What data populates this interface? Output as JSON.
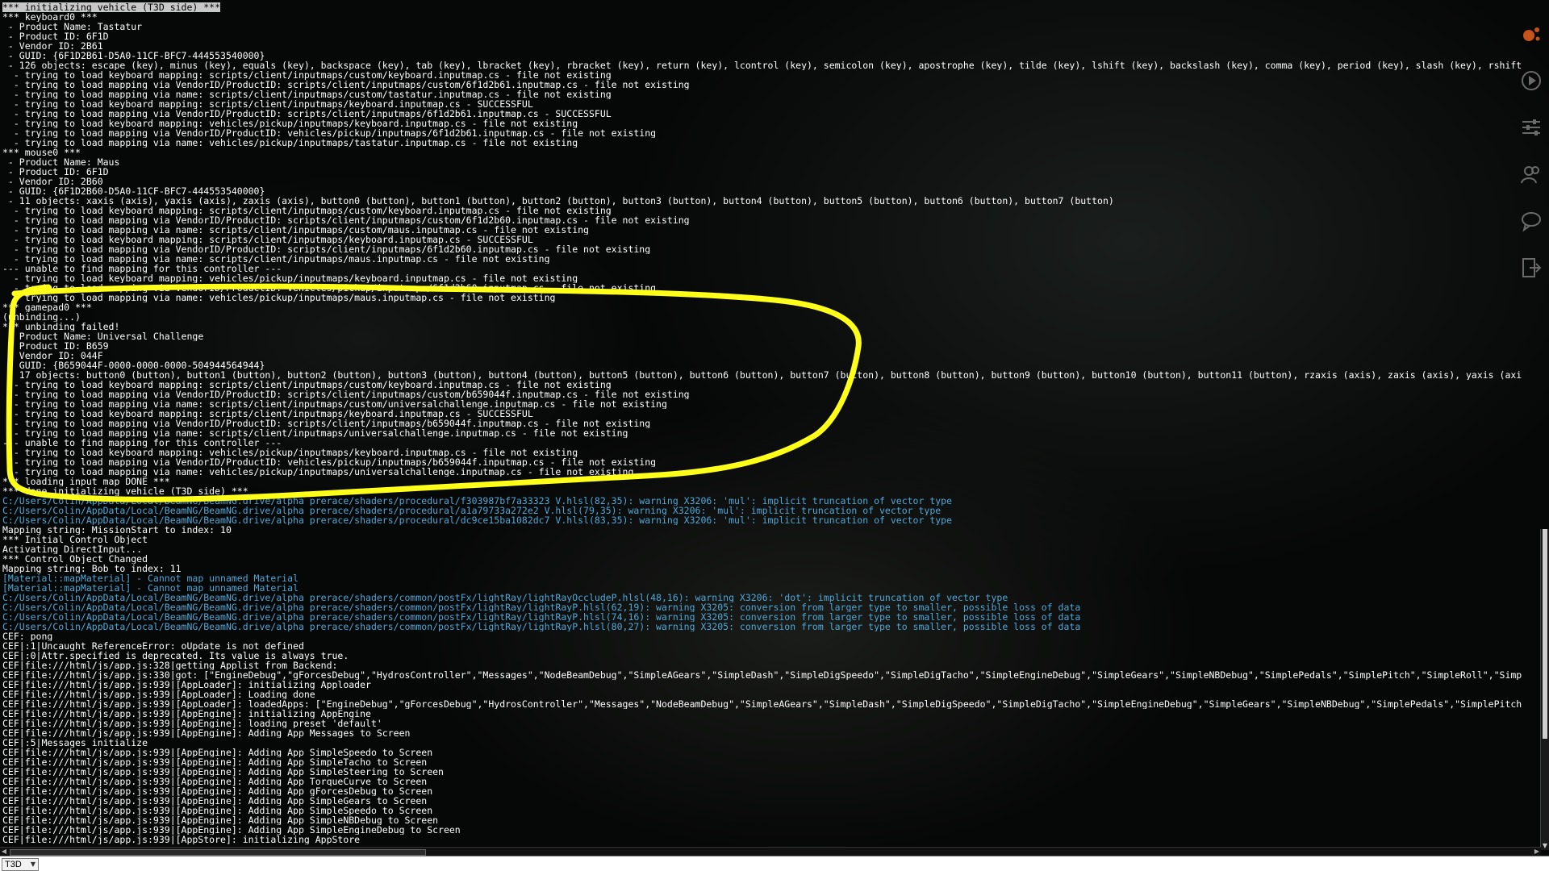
{
  "console": {
    "lines": [
      {
        "text": "*** initializing vehicle (T3D side) ***",
        "type": "normal"
      },
      {
        "text": "*** keyboard0 ***",
        "type": "normal"
      },
      {
        "text": " - Product Name: Tastatur",
        "type": "normal"
      },
      {
        "text": " - Product ID: 6F1D",
        "type": "normal"
      },
      {
        "text": " - Vendor ID: 2B61",
        "type": "normal"
      },
      {
        "text": " - GUID: {6F1D2B61-D5A0-11CF-BFC7-444553540000}",
        "type": "normal"
      },
      {
        "text": " - 126 objects: escape (key), minus (key), equals (key), backspace (key), tab (key), lbracket (key), rbracket (key), return (key), lcontrol (key), semicolon (key), apostrophe (key), tilde (key), lshift (key), backslash (key), comma (key), period (key), slash (key), rshift",
        "type": "normal"
      },
      {
        "text": "  - trying to load keyboard mapping: scripts/client/inputmaps/custom/keyboard.inputmap.cs - file not existing",
        "type": "normal"
      },
      {
        "text": "  - trying to load mapping via VendorID/ProductID: scripts/client/inputmaps/custom/6f1d2b61.inputmap.cs - file not existing",
        "type": "normal"
      },
      {
        "text": "  - trying to load mapping via name: scripts/client/inputmaps/custom/tastatur.inputmap.cs - file not existing",
        "type": "normal"
      },
      {
        "text": "  - trying to load keyboard mapping: scripts/client/inputmaps/keyboard.inputmap.cs - SUCCESSFUL",
        "type": "normal"
      },
      {
        "text": "  - trying to load mapping via VendorID/ProductID: scripts/client/inputmaps/6f1d2b61.inputmap.cs - SUCCESSFUL",
        "type": "normal"
      },
      {
        "text": "  - trying to load keyboard mapping: vehicles/pickup/inputmaps/keyboard.inputmap.cs - file not existing",
        "type": "normal"
      },
      {
        "text": "  - trying to load mapping via VendorID/ProductID: vehicles/pickup/inputmaps/6f1d2b61.inputmap.cs - file not existing",
        "type": "normal"
      },
      {
        "text": "  - trying to load mapping via name: vehicles/pickup/inputmaps/tastatur.inputmap.cs - file not existing",
        "type": "normal"
      },
      {
        "text": "*** mouse0 ***",
        "type": "normal"
      },
      {
        "text": " - Product Name: Maus",
        "type": "normal"
      },
      {
        "text": " - Product ID: 6F1D",
        "type": "normal"
      },
      {
        "text": " - Vendor ID: 2B60",
        "type": "normal"
      },
      {
        "text": " - GUID: {6F1D2B60-D5A0-11CF-BFC7-444553540000}",
        "type": "normal"
      },
      {
        "text": " - 11 objects: xaxis (axis), yaxis (axis), zaxis (axis), button0 (button), button1 (button), button2 (button), button3 (button), button4 (button), button5 (button), button6 (button), button7 (button)",
        "type": "normal"
      },
      {
        "text": "  - trying to load keyboard mapping: scripts/client/inputmaps/custom/keyboard.inputmap.cs - file not existing",
        "type": "normal"
      },
      {
        "text": "  - trying to load mapping via VendorID/ProductID: scripts/client/inputmaps/custom/6f1d2b60.inputmap.cs - file not existing",
        "type": "normal"
      },
      {
        "text": "  - trying to load mapping via name: scripts/client/inputmaps/custom/maus.inputmap.cs - file not existing",
        "type": "normal"
      },
      {
        "text": "  - trying to load keyboard mapping: scripts/client/inputmaps/keyboard.inputmap.cs - SUCCESSFUL",
        "type": "normal"
      },
      {
        "text": "  - trying to load mapping via VendorID/ProductID: scripts/client/inputmaps/6f1d2b60.inputmap.cs - file not existing",
        "type": "normal"
      },
      {
        "text": "  - trying to load mapping via name: scripts/client/inputmaps/maus.inputmap.cs - file not existing",
        "type": "normal"
      },
      {
        "text": "--- unable to find mapping for this controller ---",
        "type": "normal"
      },
      {
        "text": "  - trying to load keyboard mapping: vehicles/pickup/inputmaps/keyboard.inputmap.cs - file not existing",
        "type": "normal"
      },
      {
        "text": "  - trying to load mapping via VendorID/ProductID: vehicles/pickup/inputmaps/6f1d2b60.inputmap.cs - file not existing",
        "type": "normal"
      },
      {
        "text": "  - trying to load mapping via name: vehicles/pickup/inputmaps/maus.inputmap.cs - file not existing",
        "type": "normal"
      },
      {
        "text": "*** gamepad0 ***",
        "type": "normal"
      },
      {
        "text": "(unbinding...)",
        "type": "normal"
      },
      {
        "text": "*** unbinding failed!",
        "type": "normal"
      },
      {
        "text": " - Product Name: Universal Challenge",
        "type": "normal"
      },
      {
        "text": " - Product ID: B659",
        "type": "normal"
      },
      {
        "text": " - Vendor ID: 044F",
        "type": "normal"
      },
      {
        "text": " - GUID: {B659044F-0000-0000-0000-504944564944}",
        "type": "normal"
      },
      {
        "text": " - 17 objects: button0 (button), button1 (button), button2 (button), button3 (button), button4 (button), button5 (button), button6 (button), button7 (button), button8 (button), button9 (button), button10 (button), button11 (button), rzaxis (axis), zaxis (axis), yaxis (axi",
        "type": "normal"
      },
      {
        "text": "  - trying to load keyboard mapping: scripts/client/inputmaps/custom/keyboard.inputmap.cs - file not existing",
        "type": "normal"
      },
      {
        "text": "  - trying to load mapping via VendorID/ProductID: scripts/client/inputmaps/custom/b659044f.inputmap.cs - file not existing",
        "type": "normal"
      },
      {
        "text": "  - trying to load mapping via name: scripts/client/inputmaps/custom/universalchallenge.inputmap.cs - file not existing",
        "type": "normal"
      },
      {
        "text": "  - trying to load keyboard mapping: scripts/client/inputmaps/keyboard.inputmap.cs - SUCCESSFUL",
        "type": "normal"
      },
      {
        "text": "  - trying to load mapping via VendorID/ProductID: scripts/client/inputmaps/b659044f.inputmap.cs - file not existing",
        "type": "normal"
      },
      {
        "text": "  - trying to load mapping via name: scripts/client/inputmaps/universalchallenge.inputmap.cs - file not existing",
        "type": "normal"
      },
      {
        "text": "--- unable to find mapping for this controller ---",
        "type": "normal"
      },
      {
        "text": "  - trying to load keyboard mapping: vehicles/pickup/inputmaps/keyboard.inputmap.cs - file not existing",
        "type": "normal"
      },
      {
        "text": "  - trying to load mapping via VendorID/ProductID: vehicles/pickup/inputmaps/b659044f.inputmap.cs - file not existing",
        "type": "normal"
      },
      {
        "text": "  - trying to load mapping via name: vehicles/pickup/inputmaps/universalchallenge.inputmap.cs - file not existing",
        "type": "normal"
      },
      {
        "text": "*** loading input map DONE ***",
        "type": "normal"
      },
      {
        "text": "*** done initializing vehicle (T3D side) ***",
        "type": "normal"
      },
      {
        "text": "C:/Users/Colin/AppData/Local/BeamNG/BeamNG.drive/alpha_prerace/shaders/procedural/f303987bf7a33323_V.hlsl(82,35): warning X3206: 'mul': implicit truncation of vector type",
        "type": "warn"
      },
      {
        "text": "C:/Users/Colin/AppData/Local/BeamNG/BeamNG.drive/alpha_prerace/shaders/procedural/a1a79733a272e2_V.hlsl(79,35): warning X3206: 'mul': implicit truncation of vector type",
        "type": "warn"
      },
      {
        "text": "C:/Users/Colin/AppData/Local/BeamNG/BeamNG.drive/alpha_prerace/shaders/procedural/dc9ce15ba1082dc7_V.hlsl(83,35): warning X3206: 'mul': implicit truncation of vector type",
        "type": "warn"
      },
      {
        "text": "Mapping string: MissionStart to index: 10",
        "type": "normal"
      },
      {
        "text": "*** Initial Control Object",
        "type": "normal"
      },
      {
        "text": "Activating DirectInput...",
        "type": "normal"
      },
      {
        "text": "*** Control Object Changed",
        "type": "normal"
      },
      {
        "text": "Mapping string: Bob to index: 11",
        "type": "normal"
      },
      {
        "text": "[Material::mapMaterial] - Cannot map unnamed Material",
        "type": "warn"
      },
      {
        "text": "[Material::mapMaterial] - Cannot map unnamed Material",
        "type": "warn"
      },
      {
        "text": "C:/Users/Colin/AppData/Local/BeamNG/BeamNG.drive/alpha_prerace/shaders/common/postFx/lightRay/lightRayOccludeP.hlsl(48,16): warning X3206: 'dot': implicit truncation of vector type",
        "type": "warn"
      },
      {
        "text": "C:/Users/Colin/AppData/Local/BeamNG/BeamNG.drive/alpha_prerace/shaders/common/postFx/lightRay/lightRayP.hlsl(62,19): warning X3205: conversion from larger type to smaller, possible loss of data",
        "type": "warn"
      },
      {
        "text": "C:/Users/Colin/AppData/Local/BeamNG/BeamNG.drive/alpha_prerace/shaders/common/postFx/lightRay/lightRayP.hlsl(74,16): warning X3205: conversion from larger type to smaller, possible loss of data",
        "type": "warn"
      },
      {
        "text": "C:/Users/Colin/AppData/Local/BeamNG/BeamNG.drive/alpha_prerace/shaders/common/postFx/lightRay/lightRayP.hlsl(80,27): warning X3205: conversion from larger type to smaller, possible loss of data",
        "type": "warn"
      },
      {
        "text": "CEF: pong",
        "type": "normal"
      },
      {
        "text": "CEF|:1|Uncaught ReferenceError: oUpdate is not defined",
        "type": "normal"
      },
      {
        "text": "CEF|:0|Attr.specified is deprecated. Its value is always true.",
        "type": "normal"
      },
      {
        "text": "CEF|file:///html/js/app.js:328|getting Applist from Backend:",
        "type": "normal"
      },
      {
        "text": "CEF|file:///html/js/app.js:330|got: [\"EngineDebug\",\"gForcesDebug\",\"HydrosController\",\"Messages\",\"NodeBeamDebug\",\"SimpleAGears\",\"SimpleDash\",\"SimpleDigSpeedo\",\"SimpleDigTacho\",\"SimpleEngineDebug\",\"SimpleGears\",\"SimpleNBDebug\",\"SimplePedals\",\"SimplePitch\",\"SimpleRoll\",\"Simp",
        "type": "normal"
      },
      {
        "text": "CEF|file:///html/js/app.js:939|[AppLoader]: initializing Apploader",
        "type": "normal"
      },
      {
        "text": "CEF|file:///html/js/app.js:939|[AppLoader]: Loading done",
        "type": "normal"
      },
      {
        "text": "CEF|file:///html/js/app.js:939|[AppLoader]: loadedApps: [\"EngineDebug\",\"gForcesDebug\",\"HydrosController\",\"Messages\",\"NodeBeamDebug\",\"SimpleAGears\",\"SimpleDash\",\"SimpleDigSpeedo\",\"SimpleDigTacho\",\"SimpleEngineDebug\",\"SimpleGears\",\"SimpleNBDebug\",\"SimplePedals\",\"SimplePitch",
        "type": "normal"
      },
      {
        "text": "CEF|file:///html/js/app.js:939|[AppEngine]: initializing AppEngine",
        "type": "normal"
      },
      {
        "text": "CEF|file:///html/js/app.js:939|[AppEngine]: loading preset 'default'",
        "type": "normal"
      },
      {
        "text": "CEF|file:///html/js/app.js:939|[AppEngine]: Adding App Messages to Screen",
        "type": "normal"
      },
      {
        "text": "CEF|:5|Messages initialize",
        "type": "normal"
      },
      {
        "text": "CEF|file:///html/js/app.js:939|[AppEngine]: Adding App SimpleSpeedo to Screen",
        "type": "normal"
      },
      {
        "text": "CEF|file:///html/js/app.js:939|[AppEngine]: Adding App SimpleTacho to Screen",
        "type": "normal"
      },
      {
        "text": "CEF|file:///html/js/app.js:939|[AppEngine]: Adding App SimpleSteering to Screen",
        "type": "normal"
      },
      {
        "text": "CEF|file:///html/js/app.js:939|[AppEngine]: Adding App TorqueCurve to Screen",
        "type": "normal"
      },
      {
        "text": "CEF|file:///html/js/app.js:939|[AppEngine]: Adding App gForcesDebug to Screen",
        "type": "normal"
      },
      {
        "text": "CEF|file:///html/js/app.js:939|[AppEngine]: Adding App SimpleGears to Screen",
        "type": "normal"
      },
      {
        "text": "CEF|file:///html/js/app.js:939|[AppEngine]: Adding App SimpleSpeedo to Screen",
        "type": "normal"
      },
      {
        "text": "CEF|file:///html/js/app.js:939|[AppEngine]: Adding App SimpleNBDebug to Screen",
        "type": "normal"
      },
      {
        "text": "CEF|file:///html/js/app.js:939|[AppEngine]: Adding App SimpleEngineDebug to Screen",
        "type": "normal"
      },
      {
        "text": "CEF|file:///html/js/app.js:939|[AppStore]: initializing AppStore",
        "type": "normal"
      }
    ],
    "colors": {
      "normal": "#ffffff",
      "warn": "#4ea8d8",
      "annotation": "#ffff1a"
    }
  },
  "input_bar": {
    "context_value": "T3D",
    "command_value": ""
  },
  "side_icons": [
    "logo-icon",
    "play-icon",
    "sliders-icon",
    "users-icon",
    "chat-icon",
    "exit-icon"
  ],
  "annotation": {
    "shape": "freehand-ellipse",
    "highlights_section": "gamepad0"
  }
}
